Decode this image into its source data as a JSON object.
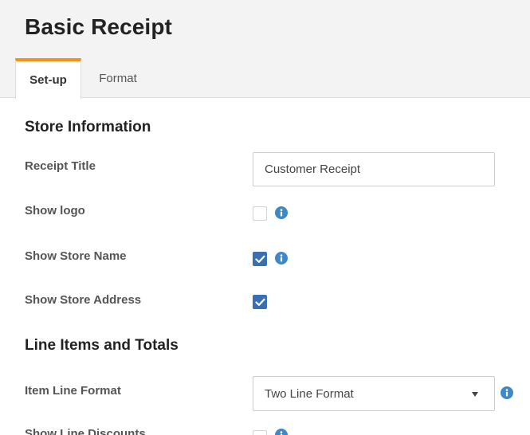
{
  "page": {
    "title": "Basic Receipt"
  },
  "tabs": [
    {
      "label": "Set-up",
      "active": true
    },
    {
      "label": "Format",
      "active": false
    }
  ],
  "store_information": {
    "section_title": "Store Information",
    "receipt_title": {
      "label": "Receipt Title",
      "value": "Customer Receipt"
    },
    "show_logo": {
      "label": "Show logo",
      "checked": false,
      "info_icon": "info-icon"
    },
    "show_store_name": {
      "label": "Show Store Name",
      "checked": true,
      "info_icon": "info-icon"
    },
    "show_store_address": {
      "label": "Show Store Address",
      "checked": true
    }
  },
  "line_items": {
    "section_title": "Line Items and Totals",
    "item_line_format": {
      "label": "Item Line Format",
      "value": "Two Line Format",
      "info_icon": "info-icon"
    },
    "show_line_discounts": {
      "label": "Show Line Discounts",
      "checked": false,
      "info_icon": "info-icon"
    }
  },
  "colors": {
    "accent_tab": "#f5921e",
    "checkbox": "#3a6fb0",
    "info": "#3f88c8",
    "header_bg": "#f3f3f3"
  }
}
